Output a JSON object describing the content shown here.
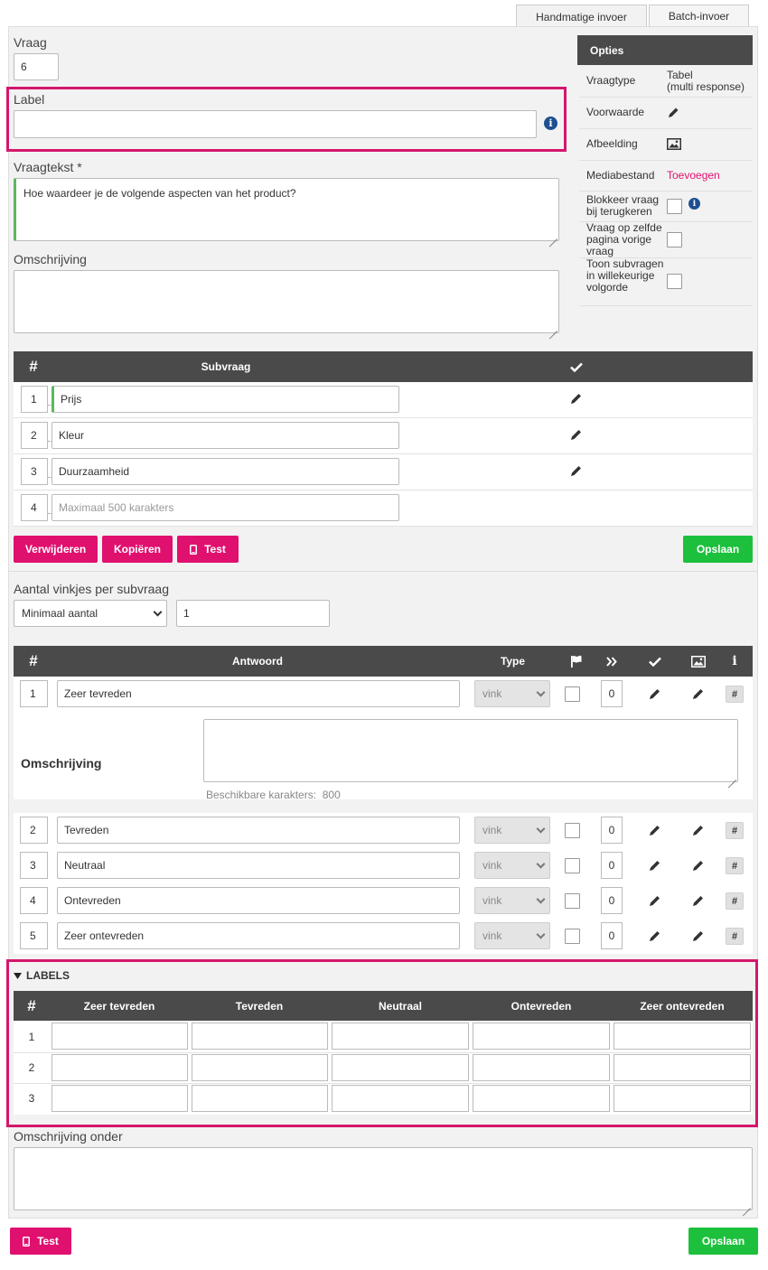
{
  "tabs": [
    {
      "label": "Handmatige invoer",
      "active": true
    },
    {
      "label": "Batch-invoer",
      "active": false
    }
  ],
  "question": {
    "number_label": "Vraag",
    "number_value": "6",
    "label_label": "Label",
    "label_value": "",
    "text_label": "Vraagtekst *",
    "text_value": "Hoe waardeer je de volgende aspecten van het product?",
    "description_label": "Omschrijving",
    "description_value": ""
  },
  "options": {
    "header": "Opties",
    "rows": [
      {
        "label": "Vraagtype",
        "value": "Tabel\n(multi response)"
      },
      {
        "label": "Voorwaarde",
        "icon": "pencil-icon"
      },
      {
        "label": "Afbeelding",
        "icon": "image-icon"
      },
      {
        "label": "Mediabestand",
        "value": "Toevoegen",
        "link": true
      },
      {
        "label": "Blokkeer vraag bij terugkeren",
        "checkbox": false,
        "info": true
      },
      {
        "label": "Vraag op zelfde pagina vorige vraag",
        "checkbox": false
      },
      {
        "label": "Toon subvragen in willekeurige volgorde",
        "checkbox": false
      }
    ]
  },
  "subquestions": {
    "header_hash": "#",
    "header_label": "Subvraag",
    "header_check_icon": "checkmark-icon",
    "rows": [
      {
        "num": "1",
        "value": "Prijs",
        "edit": true
      },
      {
        "num": "2",
        "value": "Kleur",
        "edit": true
      },
      {
        "num": "3",
        "value": "Duurzaamheid",
        "edit": true
      },
      {
        "num": "4",
        "value": "",
        "placeholder": "Maximaal 500 karakters",
        "edit": false
      }
    ]
  },
  "buttons": {
    "delete": "Verwijderen",
    "copy": "Kopiëren",
    "test": "Test",
    "save": "Opslaan"
  },
  "checks": {
    "label": "Aantal vinkjes per subvraag",
    "select_value": "Minimaal aantal",
    "value": "1"
  },
  "answers": {
    "header_hash": "#",
    "header_label": "Antwoord",
    "header_type": "Type",
    "header_icons": [
      "flag-icon",
      "double-chevron-icon",
      "checkmark-icon",
      "image-icon",
      "info-icon"
    ],
    "header_info_glyph": "i",
    "rows": [
      {
        "num": "1",
        "value": "Zeer tevreden",
        "type": "vink",
        "score": "0"
      },
      {
        "num": "2",
        "value": "Tevreden",
        "type": "vink",
        "score": "0"
      },
      {
        "num": "3",
        "value": "Neutraal",
        "type": "vink",
        "score": "0"
      },
      {
        "num": "4",
        "value": "Ontevreden",
        "type": "vink",
        "score": "0"
      },
      {
        "num": "5",
        "value": "Zeer ontevreden",
        "type": "vink",
        "score": "0"
      }
    ],
    "hash_glyph": "#",
    "description_label": "Omschrijving",
    "available_label": "Beschikbare karakters:",
    "available_value": "800"
  },
  "labels_section": {
    "title": "LABELS",
    "header_hash": "#",
    "columns": [
      "Zeer tevreden",
      "Tevreden",
      "Neutraal",
      "Ontevreden",
      "Zeer ontevreden"
    ],
    "rows": [
      "1",
      "2",
      "3"
    ]
  },
  "bottom": {
    "description_label": "Omschrijving onder",
    "test": "Test",
    "save": "Opslaan"
  },
  "colors": {
    "accent_pink": "#e0106f",
    "highlight_border": "#d4176c",
    "save_green": "#1cc03c",
    "header_dark": "#4a4a4a",
    "info_blue": "#1e4f91"
  }
}
